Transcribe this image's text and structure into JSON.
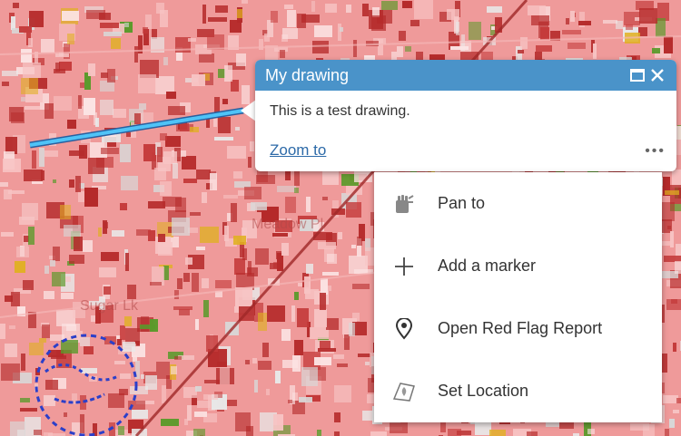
{
  "popup": {
    "title": "My drawing",
    "description": "This is a test drawing.",
    "zoom_link": "Zoom to",
    "more_label": "•••",
    "maximize_icon": "maximize-icon",
    "close_icon": "close-icon"
  },
  "menu": {
    "items": [
      {
        "label": "Pan to",
        "icon": "pan-hand-icon"
      },
      {
        "label": "Add a marker",
        "icon": "plus-icon"
      },
      {
        "label": "Open Red Flag Report",
        "icon": "location-pin-icon"
      },
      {
        "label": "Set Location",
        "icon": "set-location-icon"
      }
    ]
  },
  "map": {
    "labels": [
      "Meadow Pl",
      "Sugar Lk"
    ],
    "drawing_color": "#4fc3f7",
    "header_color": "#4a93c9"
  }
}
